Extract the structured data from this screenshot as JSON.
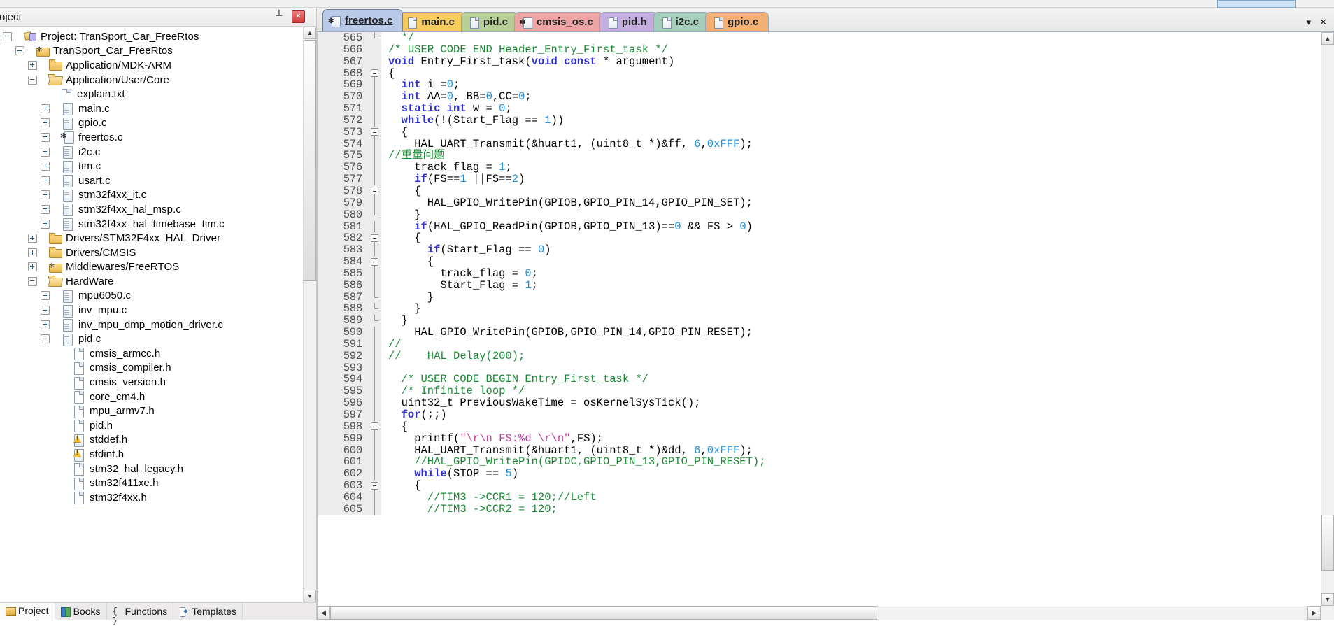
{
  "project_pane": {
    "title": "roject",
    "pin_icon": "pin-icon",
    "close_label": "×",
    "tree": [
      {
        "depth": 0,
        "exp": "minus",
        "icon": "proj",
        "label": "Project: TranSport_Car_FreeRtos"
      },
      {
        "depth": 1,
        "exp": "minus",
        "icon": "target",
        "label": "TranSport_Car_FreeRtos"
      },
      {
        "depth": 2,
        "exp": "plus",
        "icon": "folder",
        "label": "Application/MDK-ARM"
      },
      {
        "depth": 2,
        "exp": "minus",
        "icon": "folder-open",
        "label": "Application/User/Core"
      },
      {
        "depth": 3,
        "exp": "none",
        "icon": "file",
        "label": "explain.txt"
      },
      {
        "depth": 3,
        "exp": "plus",
        "icon": "src",
        "label": "main.c"
      },
      {
        "depth": 3,
        "exp": "plus",
        "icon": "src",
        "label": "gpio.c"
      },
      {
        "depth": 3,
        "exp": "plus",
        "icon": "srcstar",
        "label": "freertos.c"
      },
      {
        "depth": 3,
        "exp": "plus",
        "icon": "src",
        "label": "i2c.c"
      },
      {
        "depth": 3,
        "exp": "plus",
        "icon": "src",
        "label": "tim.c"
      },
      {
        "depth": 3,
        "exp": "plus",
        "icon": "src",
        "label": "usart.c"
      },
      {
        "depth": 3,
        "exp": "plus",
        "icon": "src",
        "label": "stm32f4xx_it.c"
      },
      {
        "depth": 3,
        "exp": "plus",
        "icon": "src",
        "label": "stm32f4xx_hal_msp.c"
      },
      {
        "depth": 3,
        "exp": "plus",
        "icon": "src",
        "label": "stm32f4xx_hal_timebase_tim.c"
      },
      {
        "depth": 2,
        "exp": "plus",
        "icon": "folder",
        "label": "Drivers/STM32F4xx_HAL_Driver"
      },
      {
        "depth": 2,
        "exp": "plus",
        "icon": "folder",
        "label": "Drivers/CMSIS"
      },
      {
        "depth": 2,
        "exp": "plus",
        "icon": "target",
        "label": "Middlewares/FreeRTOS"
      },
      {
        "depth": 2,
        "exp": "minus",
        "icon": "folder-open",
        "label": "HardWare"
      },
      {
        "depth": 3,
        "exp": "plus",
        "icon": "src",
        "label": "mpu6050.c"
      },
      {
        "depth": 3,
        "exp": "plus",
        "icon": "src",
        "label": "inv_mpu.c"
      },
      {
        "depth": 3,
        "exp": "plus",
        "icon": "src",
        "label": "inv_mpu_dmp_motion_driver.c"
      },
      {
        "depth": 3,
        "exp": "minus",
        "icon": "src",
        "label": "pid.c"
      },
      {
        "depth": 4,
        "exp": "none",
        "icon": "file",
        "label": "cmsis_armcc.h"
      },
      {
        "depth": 4,
        "exp": "none",
        "icon": "file",
        "label": "cmsis_compiler.h"
      },
      {
        "depth": 4,
        "exp": "none",
        "icon": "file",
        "label": "cmsis_version.h"
      },
      {
        "depth": 4,
        "exp": "none",
        "icon": "file",
        "label": "core_cm4.h"
      },
      {
        "depth": 4,
        "exp": "none",
        "icon": "file",
        "label": "mpu_armv7.h"
      },
      {
        "depth": 4,
        "exp": "none",
        "icon": "file",
        "label": "pid.h"
      },
      {
        "depth": 4,
        "exp": "none",
        "icon": "warn",
        "label": "stddef.h"
      },
      {
        "depth": 4,
        "exp": "none",
        "icon": "warn",
        "label": "stdint.h"
      },
      {
        "depth": 4,
        "exp": "none",
        "icon": "file",
        "label": "stm32_hal_legacy.h"
      },
      {
        "depth": 4,
        "exp": "none",
        "icon": "file",
        "label": "stm32f411xe.h"
      },
      {
        "depth": 4,
        "exp": "none",
        "icon": "file",
        "label": "stm32f4xx.h"
      }
    ],
    "bottom_tabs": [
      {
        "label": "Project",
        "icon": "project-icon",
        "active": true
      },
      {
        "label": "Books",
        "icon": "books-icon",
        "active": false
      },
      {
        "label": "Functions",
        "icon": "functions-icon",
        "active": false
      },
      {
        "label": "Templates",
        "icon": "templates-icon",
        "active": false
      }
    ]
  },
  "editor": {
    "tabs": [
      {
        "label": "freertos.c",
        "icon": "source-star-icon",
        "color": "#b9c9e8",
        "active": true
      },
      {
        "label": "main.c",
        "icon": "source-icon",
        "color": "#f7cc5e",
        "active": false
      },
      {
        "label": "pid.c",
        "icon": "source-icon",
        "color": "#b7ce96",
        "active": false
      },
      {
        "label": "cmsis_os.c",
        "icon": "source-star-icon",
        "color": "#eda4a4",
        "active": false
      },
      {
        "label": "pid.h",
        "icon": "source-icon",
        "color": "#c4aee0",
        "active": false
      },
      {
        "label": "i2c.c",
        "icon": "source-icon",
        "color": "#a5cdbc",
        "active": false
      },
      {
        "label": "gpio.c",
        "icon": "source-icon",
        "color": "#f2b075",
        "active": false
      }
    ],
    "tab_controls": {
      "dropdown": "▾",
      "close": "✕"
    },
    "first_line_number": 565,
    "lines": [
      {
        "n": 565,
        "fold": "end",
        "segs": [
          {
            "t": "  ",
            "c": ""
          },
          {
            "t": "*/",
            "c": "cmt"
          }
        ]
      },
      {
        "n": 566,
        "fold": "",
        "segs": [
          {
            "t": "/* USER CODE END Header_Entry_First_task */",
            "c": "cmt"
          }
        ]
      },
      {
        "n": 567,
        "fold": "",
        "segs": [
          {
            "t": "void",
            "c": "kw"
          },
          {
            "t": " Entry_First_task(",
            "c": ""
          },
          {
            "t": "void const",
            "c": "kw"
          },
          {
            "t": " * argument)",
            "c": ""
          }
        ]
      },
      {
        "n": 568,
        "fold": "box",
        "segs": [
          {
            "t": "{",
            "c": ""
          }
        ]
      },
      {
        "n": 569,
        "fold": "line",
        "segs": [
          {
            "t": "  ",
            "c": ""
          },
          {
            "t": "int",
            "c": "kw"
          },
          {
            "t": " i =",
            "c": ""
          },
          {
            "t": "0",
            "c": "num"
          },
          {
            "t": ";",
            "c": ""
          }
        ]
      },
      {
        "n": 570,
        "fold": "line",
        "segs": [
          {
            "t": "  ",
            "c": ""
          },
          {
            "t": "int",
            "c": "kw"
          },
          {
            "t": " AA=",
            "c": ""
          },
          {
            "t": "0",
            "c": "num"
          },
          {
            "t": ", BB=",
            "c": ""
          },
          {
            "t": "0",
            "c": "num"
          },
          {
            "t": ",CC=",
            "c": ""
          },
          {
            "t": "0",
            "c": "num"
          },
          {
            "t": ";",
            "c": ""
          }
        ]
      },
      {
        "n": 571,
        "fold": "line",
        "segs": [
          {
            "t": "  ",
            "c": ""
          },
          {
            "t": "static int",
            "c": "kw"
          },
          {
            "t": " w = ",
            "c": ""
          },
          {
            "t": "0",
            "c": "num"
          },
          {
            "t": ";",
            "c": ""
          }
        ]
      },
      {
        "n": 572,
        "fold": "line",
        "segs": [
          {
            "t": "  ",
            "c": ""
          },
          {
            "t": "while",
            "c": "kw"
          },
          {
            "t": "(!(Start_Flag == ",
            "c": ""
          },
          {
            "t": "1",
            "c": "num"
          },
          {
            "t": "))",
            "c": ""
          }
        ]
      },
      {
        "n": 573,
        "fold": "box",
        "segs": [
          {
            "t": "  {",
            "c": ""
          }
        ]
      },
      {
        "n": 574,
        "fold": "line",
        "segs": [
          {
            "t": "    HAL_UART_Transmit(&huart1, (uint8_t *)&ff, ",
            "c": ""
          },
          {
            "t": "6",
            "c": "num"
          },
          {
            "t": ",",
            "c": ""
          },
          {
            "t": "0xFFF",
            "c": "num"
          },
          {
            "t": ");",
            "c": ""
          }
        ]
      },
      {
        "n": 575,
        "fold": "line",
        "segs": [
          {
            "t": "//重量问题",
            "c": "cmt"
          }
        ]
      },
      {
        "n": 576,
        "fold": "line",
        "segs": [
          {
            "t": "    track_flag = ",
            "c": ""
          },
          {
            "t": "1",
            "c": "num"
          },
          {
            "t": ";",
            "c": ""
          }
        ]
      },
      {
        "n": 577,
        "fold": "line",
        "segs": [
          {
            "t": "    ",
            "c": ""
          },
          {
            "t": "if",
            "c": "kw"
          },
          {
            "t": "(FS==",
            "c": ""
          },
          {
            "t": "1",
            "c": "num"
          },
          {
            "t": " ||FS==",
            "c": ""
          },
          {
            "t": "2",
            "c": "num"
          },
          {
            "t": ")",
            "c": ""
          }
        ]
      },
      {
        "n": 578,
        "fold": "box",
        "segs": [
          {
            "t": "    {",
            "c": ""
          }
        ]
      },
      {
        "n": 579,
        "fold": "line",
        "segs": [
          {
            "t": "      HAL_GPIO_WritePin(GPIOB,GPIO_PIN_14,GPIO_PIN_SET);",
            "c": ""
          }
        ]
      },
      {
        "n": 580,
        "fold": "end",
        "segs": [
          {
            "t": "    }",
            "c": ""
          }
        ]
      },
      {
        "n": 581,
        "fold": "line",
        "segs": [
          {
            "t": "    ",
            "c": ""
          },
          {
            "t": "if",
            "c": "kw"
          },
          {
            "t": "(HAL_GPIO_ReadPin(GPIOB,GPIO_PIN_13)==",
            "c": ""
          },
          {
            "t": "0",
            "c": "num"
          },
          {
            "t": " && FS > ",
            "c": ""
          },
          {
            "t": "0",
            "c": "num"
          },
          {
            "t": ")",
            "c": ""
          }
        ]
      },
      {
        "n": 582,
        "fold": "box",
        "segs": [
          {
            "t": "    {",
            "c": ""
          }
        ]
      },
      {
        "n": 583,
        "fold": "line",
        "segs": [
          {
            "t": "      ",
            "c": ""
          },
          {
            "t": "if",
            "c": "kw"
          },
          {
            "t": "(Start_Flag == ",
            "c": ""
          },
          {
            "t": "0",
            "c": "num"
          },
          {
            "t": ")",
            "c": ""
          }
        ]
      },
      {
        "n": 584,
        "fold": "box",
        "segs": [
          {
            "t": "      {",
            "c": ""
          }
        ]
      },
      {
        "n": 585,
        "fold": "line",
        "segs": [
          {
            "t": "        track_flag = ",
            "c": ""
          },
          {
            "t": "0",
            "c": "num"
          },
          {
            "t": ";",
            "c": ""
          }
        ]
      },
      {
        "n": 586,
        "fold": "line",
        "segs": [
          {
            "t": "        Start_Flag = ",
            "c": ""
          },
          {
            "t": "1",
            "c": "num"
          },
          {
            "t": ";",
            "c": ""
          }
        ]
      },
      {
        "n": 587,
        "fold": "end",
        "segs": [
          {
            "t": "      }",
            "c": ""
          }
        ]
      },
      {
        "n": 588,
        "fold": "end",
        "segs": [
          {
            "t": "    }",
            "c": ""
          }
        ]
      },
      {
        "n": 589,
        "fold": "end",
        "segs": [
          {
            "t": "  }",
            "c": ""
          }
        ]
      },
      {
        "n": 590,
        "fold": "line",
        "segs": [
          {
            "t": "    HAL_GPIO_WritePin(GPIOB,GPIO_PIN_14,GPIO_PIN_RESET);",
            "c": ""
          }
        ]
      },
      {
        "n": 591,
        "fold": "line",
        "segs": [
          {
            "t": "//",
            "c": "cmt"
          }
        ]
      },
      {
        "n": 592,
        "fold": "line",
        "segs": [
          {
            "t": "//    HAL_Delay(200);",
            "c": "cmt"
          }
        ]
      },
      {
        "n": 593,
        "fold": "line",
        "segs": [
          {
            "t": "",
            "c": ""
          }
        ]
      },
      {
        "n": 594,
        "fold": "line",
        "segs": [
          {
            "t": "  /* USER CODE BEGIN Entry_First_task */",
            "c": "cmt"
          }
        ]
      },
      {
        "n": 595,
        "fold": "line",
        "segs": [
          {
            "t": "  /* Infinite loop */",
            "c": "cmt"
          }
        ]
      },
      {
        "n": 596,
        "fold": "line",
        "segs": [
          {
            "t": "  uint32_t PreviousWakeTime = osKernelSysTick();",
            "c": ""
          }
        ]
      },
      {
        "n": 597,
        "fold": "line",
        "segs": [
          {
            "t": "  ",
            "c": ""
          },
          {
            "t": "for",
            "c": "kw"
          },
          {
            "t": "(;;)",
            "c": ""
          }
        ]
      },
      {
        "n": 598,
        "fold": "box",
        "segs": [
          {
            "t": "  {",
            "c": ""
          }
        ]
      },
      {
        "n": 599,
        "fold": "line",
        "segs": [
          {
            "t": "    printf(",
            "c": ""
          },
          {
            "t": "\"\\r\\n FS:%d \\r\\n\"",
            "c": "str"
          },
          {
            "t": ",FS);",
            "c": ""
          }
        ]
      },
      {
        "n": 600,
        "fold": "line",
        "segs": [
          {
            "t": "    HAL_UART_Transmit(&huart1, (uint8_t *)&dd, ",
            "c": ""
          },
          {
            "t": "6",
            "c": "num"
          },
          {
            "t": ",",
            "c": ""
          },
          {
            "t": "0xFFF",
            "c": "num"
          },
          {
            "t": ");",
            "c": ""
          }
        ]
      },
      {
        "n": 601,
        "fold": "line",
        "segs": [
          {
            "t": "    //HAL_GPIO_WritePin(GPIOC,GPIO_PIN_13,GPIO_PIN_RESET);",
            "c": "cmt"
          }
        ]
      },
      {
        "n": 602,
        "fold": "line",
        "segs": [
          {
            "t": "    ",
            "c": ""
          },
          {
            "t": "while",
            "c": "kw"
          },
          {
            "t": "(STOP == ",
            "c": ""
          },
          {
            "t": "5",
            "c": "num"
          },
          {
            "t": ")",
            "c": ""
          }
        ]
      },
      {
        "n": 603,
        "fold": "box",
        "segs": [
          {
            "t": "    {",
            "c": ""
          }
        ]
      },
      {
        "n": 604,
        "fold": "line",
        "segs": [
          {
            "t": "      //TIM3 ->CCR1 = 120;//Left",
            "c": "cmt"
          }
        ]
      },
      {
        "n": 605,
        "fold": "line",
        "segs": [
          {
            "t": "      //TIM3 ->CCR2 = 120;",
            "c": "cmt"
          }
        ]
      }
    ],
    "scroll": {
      "up_arrow": "▲",
      "down_arrow": "▼",
      "left_arrow": "◀",
      "right_arrow": "▶"
    }
  }
}
